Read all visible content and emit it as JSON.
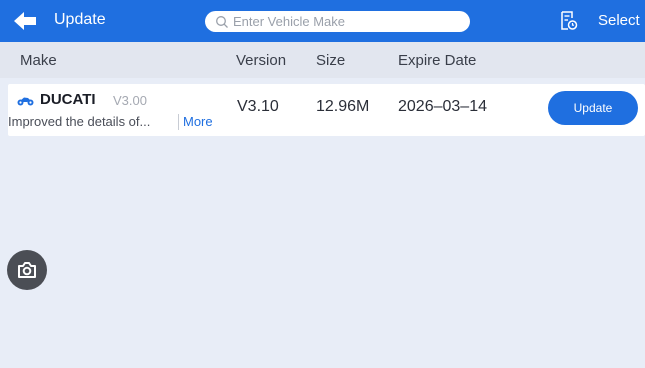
{
  "topbar": {
    "title": "Update",
    "search_placeholder": "Enter Vehicle Make",
    "select_label": "Select",
    "accent": "#1f6fe0"
  },
  "columns": {
    "make": "Make",
    "version": "Version",
    "size": "Size",
    "expire": "Expire Date"
  },
  "rows": [
    {
      "icon": "motorcycle-icon",
      "make": "DUCATI",
      "current_version": "V3.00",
      "description": "Improved the details of...",
      "more_label": "More",
      "version": "V3.10",
      "size": "12.96M",
      "expire_date": "2026–03–14",
      "button_label": "Update"
    }
  ],
  "icons": {
    "back": "back-arrow-icon",
    "search": "search-icon",
    "select": "select-document-icon",
    "camera": "camera-icon"
  }
}
